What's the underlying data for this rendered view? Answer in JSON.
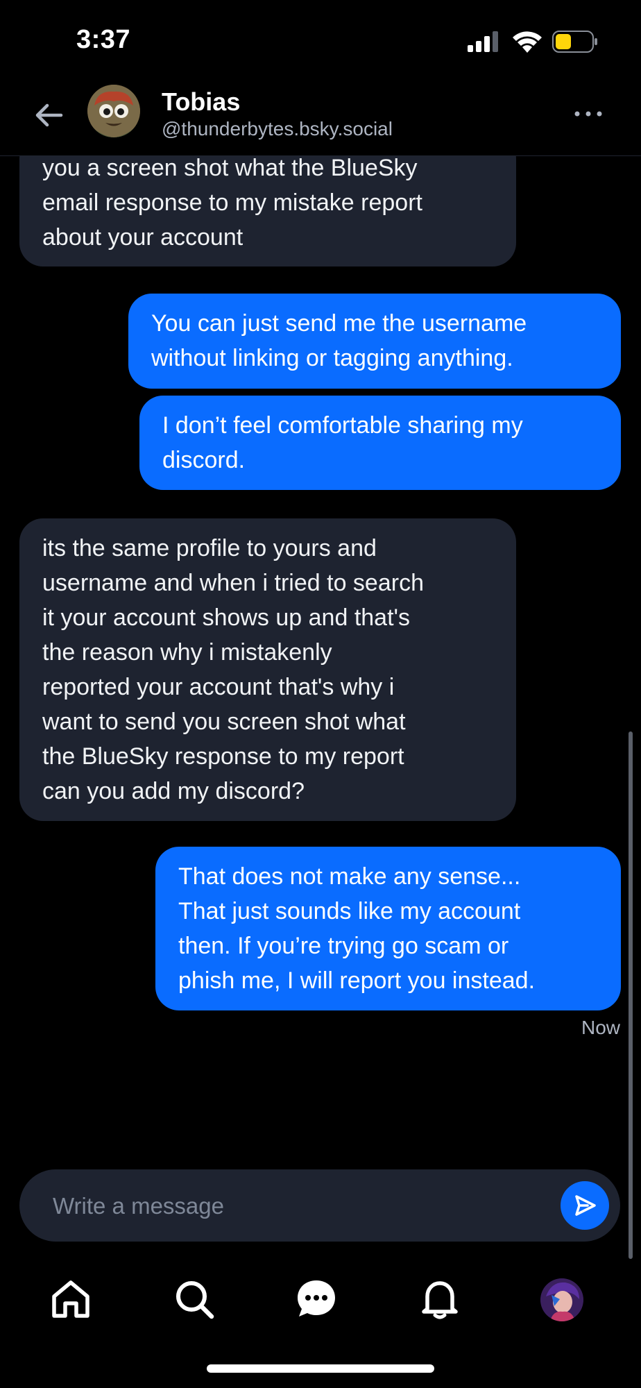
{
  "status_bar": {
    "time": "3:37"
  },
  "header": {
    "name": "Tobias",
    "handle": "@thunderbytes.bsky.social",
    "back_icon": "arrow-left-icon",
    "more_icon": "ellipsis-icon"
  },
  "messages": [
    {
      "direction": "incoming",
      "lines": [
        "you a screen shot what the BlueSky",
        "email response to my mistake report",
        "about your account"
      ]
    },
    {
      "direction": "outgoing",
      "lines": [
        "You can just send me the username",
        "without linking or tagging anything."
      ]
    },
    {
      "direction": "outgoing",
      "lines": [
        "I don’t feel comfortable sharing my",
        "discord."
      ]
    },
    {
      "direction": "incoming",
      "lines": [
        "its the same profile to yours and",
        "username and when i tried to search",
        "it your account shows up and that's",
        "the reason why i mistakenly",
        "reported your account that's why i",
        "want to send you screen shot what",
        "the BlueSky response to my report",
        "can you add my discord?"
      ]
    },
    {
      "direction": "outgoing",
      "lines": [
        "That does not make any sense...",
        "That just sounds like my account",
        "then. If you’re trying go scam or",
        "phish me, I will report you instead."
      ]
    }
  ],
  "timestamp": "Now",
  "composer": {
    "placeholder": "Write a message",
    "send_icon": "send-icon"
  },
  "nav": {
    "items": [
      "home-icon",
      "search-icon",
      "chat-icon",
      "bell-icon",
      "profile-avatar"
    ]
  },
  "colors": {
    "background": "#000000",
    "incoming_bubble": "#1e2330",
    "outgoing_bubble": "#0a6cff",
    "secondary_text": "#aeb5c2",
    "battery": "#ffd60a"
  }
}
